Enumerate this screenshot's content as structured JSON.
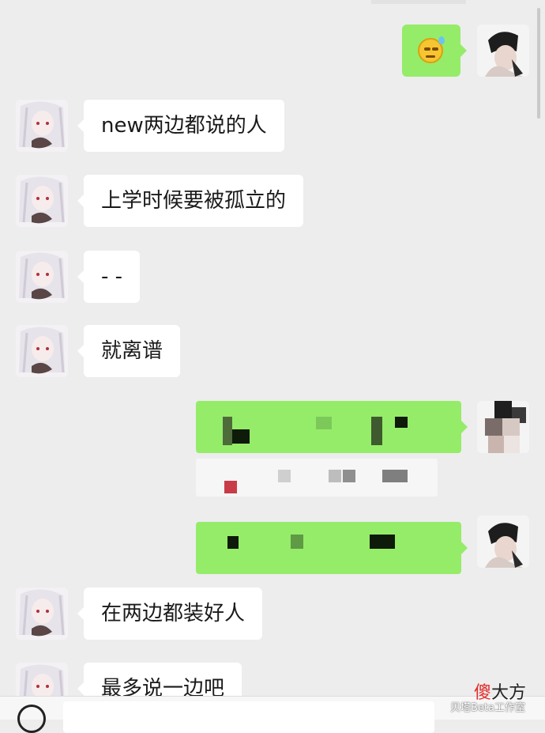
{
  "messages_left": [
    {
      "text": "new两边都说的人"
    },
    {
      "text": "上学时候要被孤立的"
    },
    {
      "text": "- -"
    },
    {
      "text": "就离谱"
    },
    {
      "text": "在两边都装好人"
    },
    {
      "text": "最多说一边吧"
    }
  ],
  "watermark": {
    "red_part": "傻",
    "black_part": "大方",
    "sub": "贝塔Beta工作室"
  },
  "colors": {
    "sent_bubble": "#95ec69",
    "received_bubble": "#ffffff",
    "background": "#ededed"
  }
}
